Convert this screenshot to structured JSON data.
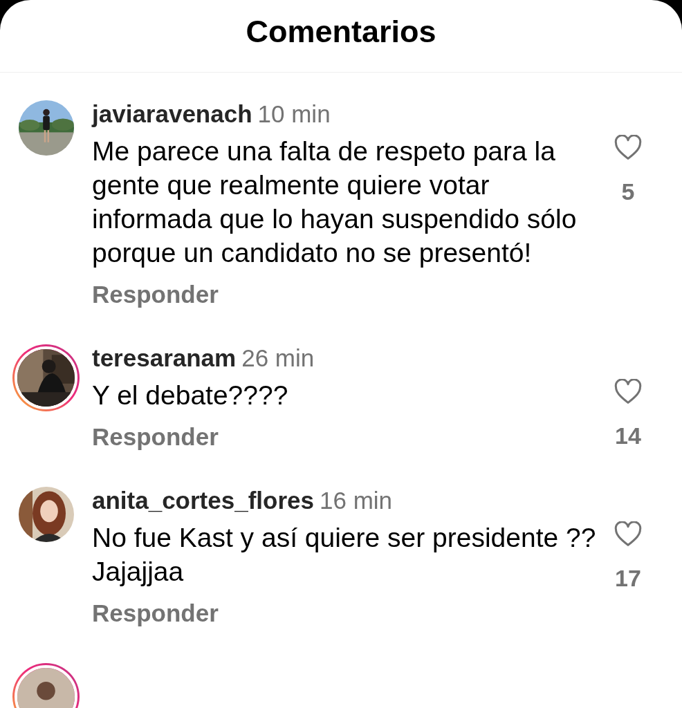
{
  "header": {
    "title": "Comentarios"
  },
  "comments": [
    {
      "username": "javiaravenach",
      "time": "10 min",
      "text": "Me parece una falta de respeto para la gente que realmente quiere votar informada que lo hayan suspendido sólo porque un candidato no se presentó!",
      "likes": "5",
      "reply": "Responder",
      "story_ring": false
    },
    {
      "username": "teresaranam",
      "time": "26 min",
      "text": "Y el debate????",
      "likes": "14",
      "reply": "Responder",
      "story_ring": true
    },
    {
      "username": "anita_cortes_flores",
      "time": "16 min",
      "text": "No fue Kast y así quiere ser presidente ?? Jajajjaa",
      "likes": "17",
      "reply": "Responder",
      "story_ring": false
    },
    {
      "story_ring": true
    }
  ]
}
